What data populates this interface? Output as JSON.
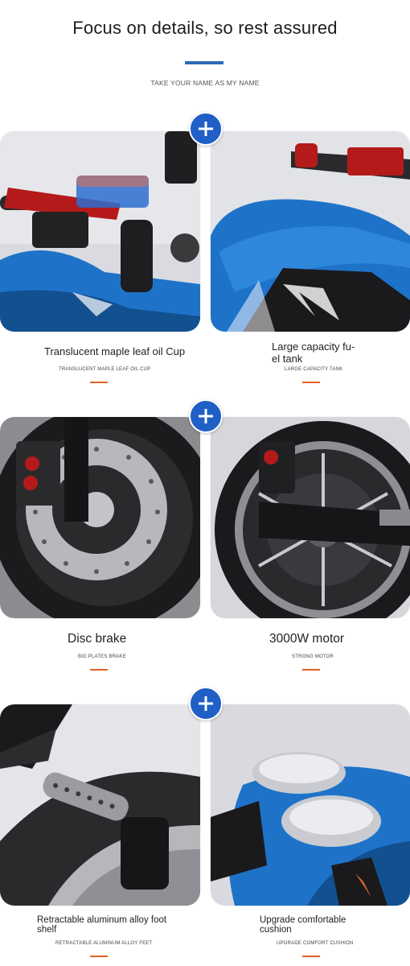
{
  "header": {
    "title": "Focus on details, so rest assured",
    "subtitle": "TAKE YOUR NAME AS MY NAME"
  },
  "colors": {
    "accent_blue": "#2c6ab8",
    "plus_blue": "#1f5fc6",
    "dash_orange": "#e0612a",
    "bike_blue": "#1e73c9",
    "bike_red": "#b51a1a"
  },
  "features": [
    {
      "title": "Translucent maple leaf oil Cup",
      "subtitle": "TRANSLUCENT MAPLE LEAF OIL CUP",
      "image": "oil-cup-photo"
    },
    {
      "title": "Large capacity fu-\nel tank",
      "subtitle": "LARGE CAPACITY TANK",
      "image": "fuel-tank-photo"
    },
    {
      "title": "Disc brake",
      "subtitle": "BIG PLATES BRAKE",
      "image": "disc-brake-photo"
    },
    {
      "title": "3000W motor",
      "subtitle": "STRONG MOTOR",
      "image": "motor-photo"
    },
    {
      "title": "Retractable aluminum alloy foot shelf",
      "subtitle": "RETRACTABLE ALUMINUM ALLOY FEET",
      "image": "foot-peg-photo"
    },
    {
      "title": "Upgrade comfortable cushion",
      "subtitle": "UPGRADE COMFORT CUSHION",
      "image": "seat-photo"
    }
  ],
  "icons": {
    "plus": "plus-icon"
  }
}
